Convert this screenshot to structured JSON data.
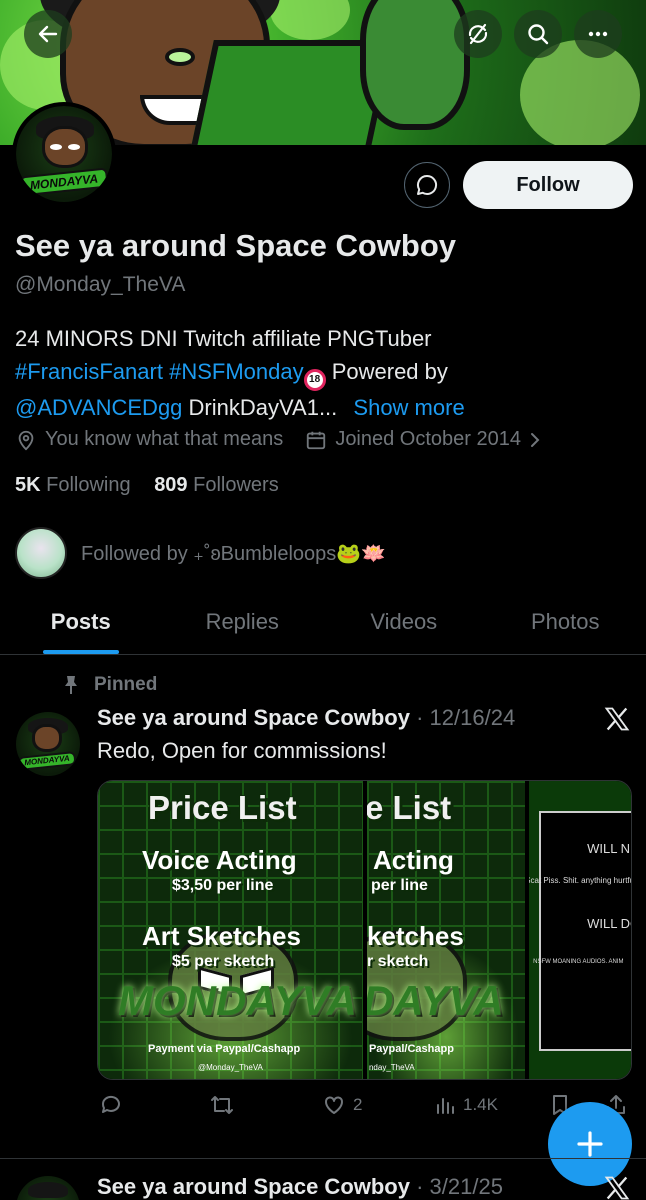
{
  "profile": {
    "name": "See ya around Space Cowboy",
    "handle": "@Monday_TheVA",
    "follow_label": "Follow",
    "avatar_text": "MONDAYVA",
    "bio_line1": "24 MINORS DNI Twitch affiliate PNGTuber",
    "bio_tag1": "#FrancisFanart",
    "bio_tag2": "#NSFMonday",
    "nsfw_badge": "18",
    "bio_powered": " Powered by",
    "bio_mention": "@ADVANCEDgg",
    "bio_rest": " DrinkDayVA1...",
    "show_more": "Show more",
    "location": "You know what that means",
    "joined": "Joined October 2014",
    "following_count": "5K",
    "following_label": "Following",
    "followers_count": "809",
    "followers_label": "Followers",
    "followed_by": "Followed by ₊˚ʚBumbleloops🐸🪷"
  },
  "tabs": [
    {
      "label": "Posts",
      "active": true
    },
    {
      "label": "Replies",
      "active": false
    },
    {
      "label": "Videos",
      "active": false
    },
    {
      "label": "Photos",
      "active": false
    }
  ],
  "pinned_post": {
    "pinned_label": "Pinned",
    "author": "See ya around Space Cowboy",
    "date": "· 12/16/24",
    "text": "Redo, Open for commissions!",
    "media": {
      "title": "Price List",
      "title_cropped": "e List",
      "voice": "Voice Acting",
      "voice_cropped": "Acting",
      "voice_price": "$3,50 per line",
      "voice_price_cropped": "per line",
      "art": "Art Sketches",
      "art_cropped": "ketches",
      "art_price": "$5 per sketch",
      "art_price_cropped": "r sketch",
      "logo": "MONDAYVA",
      "logo_cropped": "DAYVA",
      "payment": "Payment via Paypal/Cashapp",
      "payment_cropped": "Paypal/Cashapp",
      "handle": "@Monday_TheVA",
      "handle_cropped": "nday_TheVA",
      "will_not": "WILL N",
      "will_not_items": "Scat Piss. Shit. anything hurtful",
      "will_do": "WILL DO",
      "will_do_items": "NSFW MOANING AUDIOS. ANIM"
    },
    "likes": "2",
    "views": "1.4K"
  },
  "second_post": {
    "author": "See ya around Space Cowboy",
    "date": "· 3/21/25"
  },
  "icons": {
    "back": "back-arrow-icon",
    "sync": "sync-icon",
    "search": "search-icon",
    "more": "more-icon",
    "message": "message-icon",
    "location": "location-icon",
    "calendar": "calendar-icon",
    "chevron": "chevron-right-icon",
    "pin": "pin-icon",
    "x_logo": "x-logo-icon",
    "reply": "reply-icon",
    "repost": "repost-icon",
    "like": "heart-icon",
    "views": "views-icon",
    "bookmark": "bookmark-icon",
    "share": "share-icon",
    "compose": "plus-icon"
  },
  "colors": {
    "accent": "#1d9bf0",
    "background": "#000000",
    "text": "#e7e9ea",
    "muted": "#71767b"
  }
}
